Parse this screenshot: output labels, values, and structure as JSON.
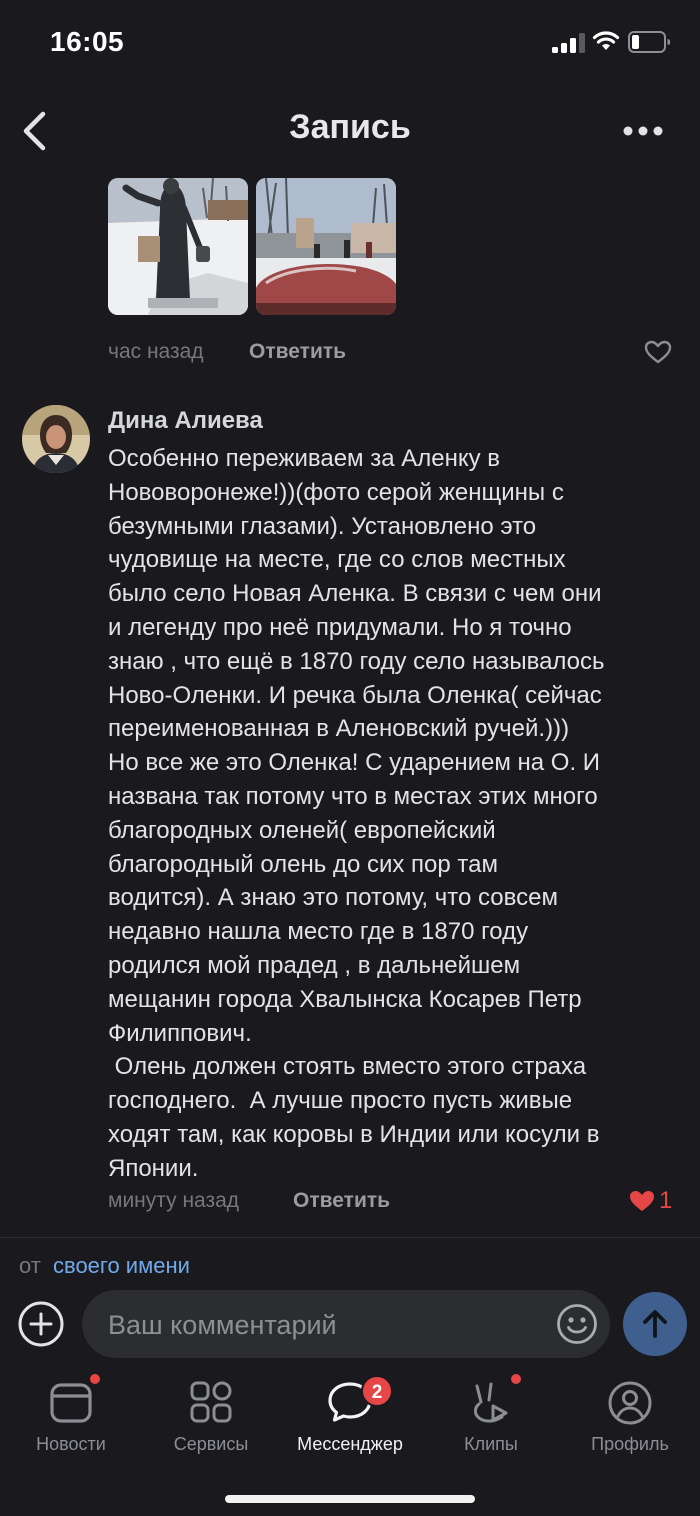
{
  "status_bar": {
    "time": "16:05"
  },
  "header": {
    "title": "Запись"
  },
  "prev_comment": {
    "time": "час назад",
    "reply_label": "Ответить"
  },
  "comment": {
    "author": "Дина Алиева",
    "text": "Особенно переживаем за Аленку в\nНововоронеже!))(фото серой женщины с\nбезумными глазами). Установлено это\nчудовище на месте, где со слов местных\nбыло село Новая Аленка. В связи с чем они\nи легенду про неё придумали. Но я точно\nзнаю , что ещё в 1870 году село называлось\nНово-Оленки. И речка была Оленка( сейчас\nпереименованная в Аленовский ручей.)))\nНо все же это Оленка! С ударением на О. И\nназвана так потому что в местах этих много\nблагородных оленей( европейский\nблагородный олень до сих пор там\nводится). А знаю это потому, что совсем\nнедавно нашла место где в 1870 году\nродился мой прадед , в дальнейшем\nмещанин города Хвалынска Косарев Петр\nФилиппович.\n Олень должен стоять вместо этого страха\nгосподнего.  А лучше просто пусть живые\nходят там, как коровы в Индии или косули в\nЯпонии.",
    "time": "минуту назад",
    "reply_label": "Ответить",
    "likes": "1",
    "liked": true
  },
  "composer": {
    "from_prefix": "от",
    "from_link": "своего имени",
    "placeholder": "Ваш комментарий"
  },
  "tabbar": {
    "items": [
      {
        "label": "Новости",
        "icon": "news-icon",
        "dot": true
      },
      {
        "label": "Сервисы",
        "icon": "services-icon",
        "dot": false
      },
      {
        "label": "Мессенджер",
        "icon": "messenger-icon",
        "badge": "2",
        "active": true
      },
      {
        "label": "Клипы",
        "icon": "clips-icon",
        "dot": true
      },
      {
        "label": "Профиль",
        "icon": "profile-icon",
        "dot": false
      }
    ]
  },
  "colors": {
    "accent": "#71aaeb",
    "like": "#e64646",
    "background": "#1a191e",
    "send_button": "#3f608f"
  }
}
